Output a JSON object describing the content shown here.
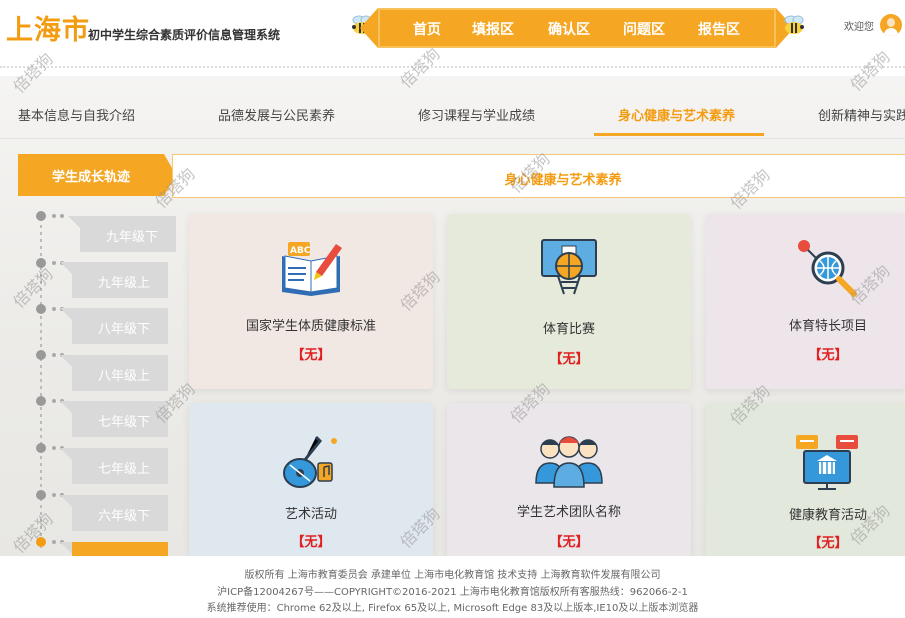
{
  "header": {
    "city": "上海市",
    "system_name": "初中学生综合素质评价信息管理系统",
    "nav": [
      "首页",
      "填报区",
      "确认区",
      "问题区",
      "报告区"
    ],
    "welcome": "欢迎您"
  },
  "tabs": {
    "items": [
      "基本信息与自我介绍",
      "品德发展与公民素养",
      "修习课程与学业成绩",
      "身心健康与艺术素养",
      "创新精神与实践"
    ],
    "active_index": 3
  },
  "sidebar": {
    "title": "学生成长轨迹",
    "grades": [
      "九年级下",
      "九年级上",
      "八年级下",
      "八年级上",
      "七年级下",
      "七年级上",
      "六年级下"
    ]
  },
  "section": {
    "title": "身心健康与艺术素养"
  },
  "cards": [
    {
      "title": "国家学生体质健康标准",
      "status": "【无】",
      "icon": "abc-book-icon"
    },
    {
      "title": "体育比赛",
      "status": "【无】",
      "icon": "basketball-hoop-icon"
    },
    {
      "title": "体育特长项目",
      "status": "【无】",
      "icon": "globe-magnifier-icon"
    },
    {
      "title": "艺术活动",
      "status": "【无】",
      "icon": "guitar-music-icon"
    },
    {
      "title": "学生艺术团队名称",
      "status": "【无】",
      "icon": "team-people-icon"
    },
    {
      "title": "健康教育活动",
      "status": "【无】",
      "icon": "presentation-screen-icon"
    }
  ],
  "footer": {
    "line1": "版权所有 上海市教育委员会    承建单位 上海市电化教育馆    技术支持 上海教育软件发展有限公司",
    "line2": "沪ICP备12004267号——COPYRIGHT©2016-2021 上海市电化教育馆版权所有客服热线：962066-2-1",
    "line3": "系统推荐使用：Chrome 62及以上, Firefox 65及以上, Microsoft Edge 83及以上版本,IE10及以上版本浏览器"
  },
  "watermark": "倍塔狗",
  "colors": {
    "accent": "#f5a623",
    "status_red": "#e02020"
  }
}
